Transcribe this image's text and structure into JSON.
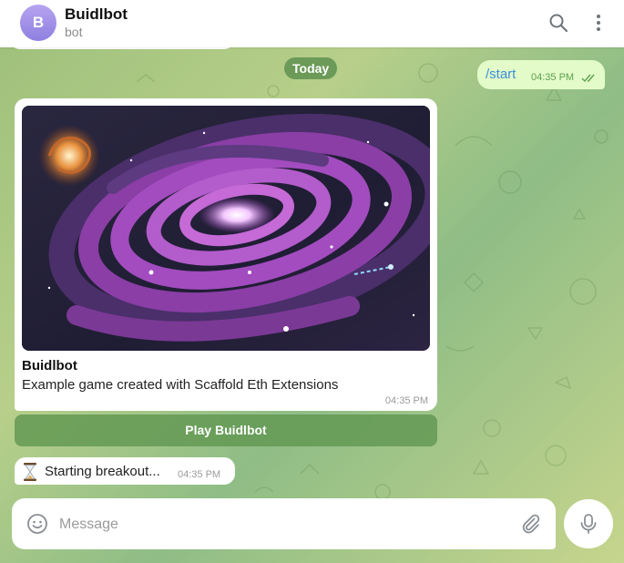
{
  "header": {
    "avatar_letter": "B",
    "title": "Buidlbot",
    "subtitle": "bot",
    "icons": [
      "search-icon",
      "more-vertical-icon"
    ]
  },
  "chat": {
    "date_label": "Today",
    "outgoing": {
      "text": "/start",
      "time": "04:35 PM",
      "status_icon": "double-check-icon"
    },
    "game": {
      "name": "Buidlbot",
      "description": "Example game created with Scaffold Eth Extensions",
      "time": "04:35 PM",
      "image_desc_icon": "galaxy-image",
      "play_label": "Play Buidlbot"
    },
    "status": {
      "icon": "hourglass-icon",
      "text": "Starting breakout...",
      "time": "04:35 PM"
    }
  },
  "composer": {
    "placeholder": "Message",
    "icons": [
      "emoji-icon",
      "attach-icon",
      "microphone-icon"
    ]
  },
  "colors": {
    "outgoing_bubble": "#e3fbc9",
    "accent_link": "#3a8fd9",
    "button_green": "#5f9650",
    "avatar_purple": "#9d8de6"
  }
}
